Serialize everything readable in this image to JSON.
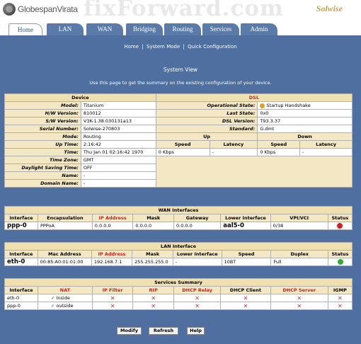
{
  "logo_text": "GlobespanVirata",
  "brand": "Solwise",
  "watermark": "fixForward.com",
  "tabs": [
    "Home",
    "LAN",
    "WAN",
    "Bridging",
    "Routing",
    "Services",
    "Admin"
  ],
  "sublinks": {
    "home": "Home",
    "sep1": "|",
    "system": "System Mode",
    "sep2": "|",
    "quick": "Quick Configuration"
  },
  "page_title": "System View",
  "description": "Use this page to get the summary on the existing configuration of your device.",
  "device": {
    "header": "Device",
    "rows": [
      {
        "label": "Model:",
        "value": "Titanium"
      },
      {
        "label": "H/W Version:",
        "value": "810012"
      },
      {
        "label": "S/W Version:",
        "value": "V3K-1.38.030131a13"
      },
      {
        "label": "Serial Number:",
        "value": "Solwise-270803"
      },
      {
        "label": "Mode:",
        "value": "Routing"
      },
      {
        "label": "Up Time:",
        "value": "2:16:42"
      },
      {
        "label": "Time:",
        "value": "Thu Jan 01 02:16:42 1970"
      },
      {
        "label": "Time Zone:",
        "value": "GMT"
      },
      {
        "label": "Daylight Saving Time:",
        "value": "OFF"
      },
      {
        "label": "Name:",
        "value": "-"
      },
      {
        "label": "Domain Name:",
        "value": "-"
      }
    ]
  },
  "dsl": {
    "header": "DSL",
    "operational_state_label": "Operational State:",
    "operational_state": "Startup Handshake",
    "last_state_label": "Last State:",
    "last_state": "0x0",
    "dsl_version_label": "DSL Version:",
    "dsl_version": "T93.3.37",
    "standard_label": "Standard:",
    "standard": "G.dmt",
    "up": "Up",
    "down": "Down",
    "speed": "Speed",
    "latency": "Latency",
    "up_speed": "0 Kbps",
    "up_latency": "-",
    "down_speed": "0 Kbps",
    "down_latency": "-"
  },
  "wan": {
    "caption": "WAN Interfaces",
    "columns": [
      "Interface",
      "Encapsulation",
      "IP Address",
      "Mask",
      "Gateway",
      "Lower Interface",
      "VPI/VCI",
      "Status"
    ],
    "row": {
      "interface": "ppp-0",
      "encapsulation": "PPPoA",
      "ip": "0.0.0.0",
      "mask": "0.0.0.0",
      "gateway": "0.0.0.0",
      "lower": "aal5-0",
      "vpivci": "0/38",
      "status_color": "#cc2222"
    }
  },
  "lan": {
    "caption": "LAN Interface",
    "columns": [
      "Interface",
      "Mac Address",
      "IP Address",
      "Mask",
      "Lower Interface",
      "Speed",
      "Duplex",
      "Status"
    ],
    "row": {
      "interface": "eth-0",
      "mac": "00:85:A0:01:01:00",
      "ip": "192.168.7.1",
      "mask": "255.255.255.0",
      "lower": "-",
      "speed": "10BT",
      "duplex": "Full",
      "status_color": "#33aa33"
    }
  },
  "services": {
    "caption": "Services Summary",
    "columns": [
      "Interface",
      "NAT",
      "IP Filter",
      "RIP",
      "DHCP Relay",
      "DHCP Client",
      "DHCP Server",
      "IGMP"
    ],
    "rows": [
      {
        "interface": "eth-0",
        "nat": "Inside"
      },
      {
        "interface": "ppp-0",
        "nat": "outside"
      }
    ],
    "x": "✕",
    "check": "✓"
  },
  "buttons": {
    "modify": "Modify",
    "refresh": "Refresh",
    "help": "Help"
  }
}
